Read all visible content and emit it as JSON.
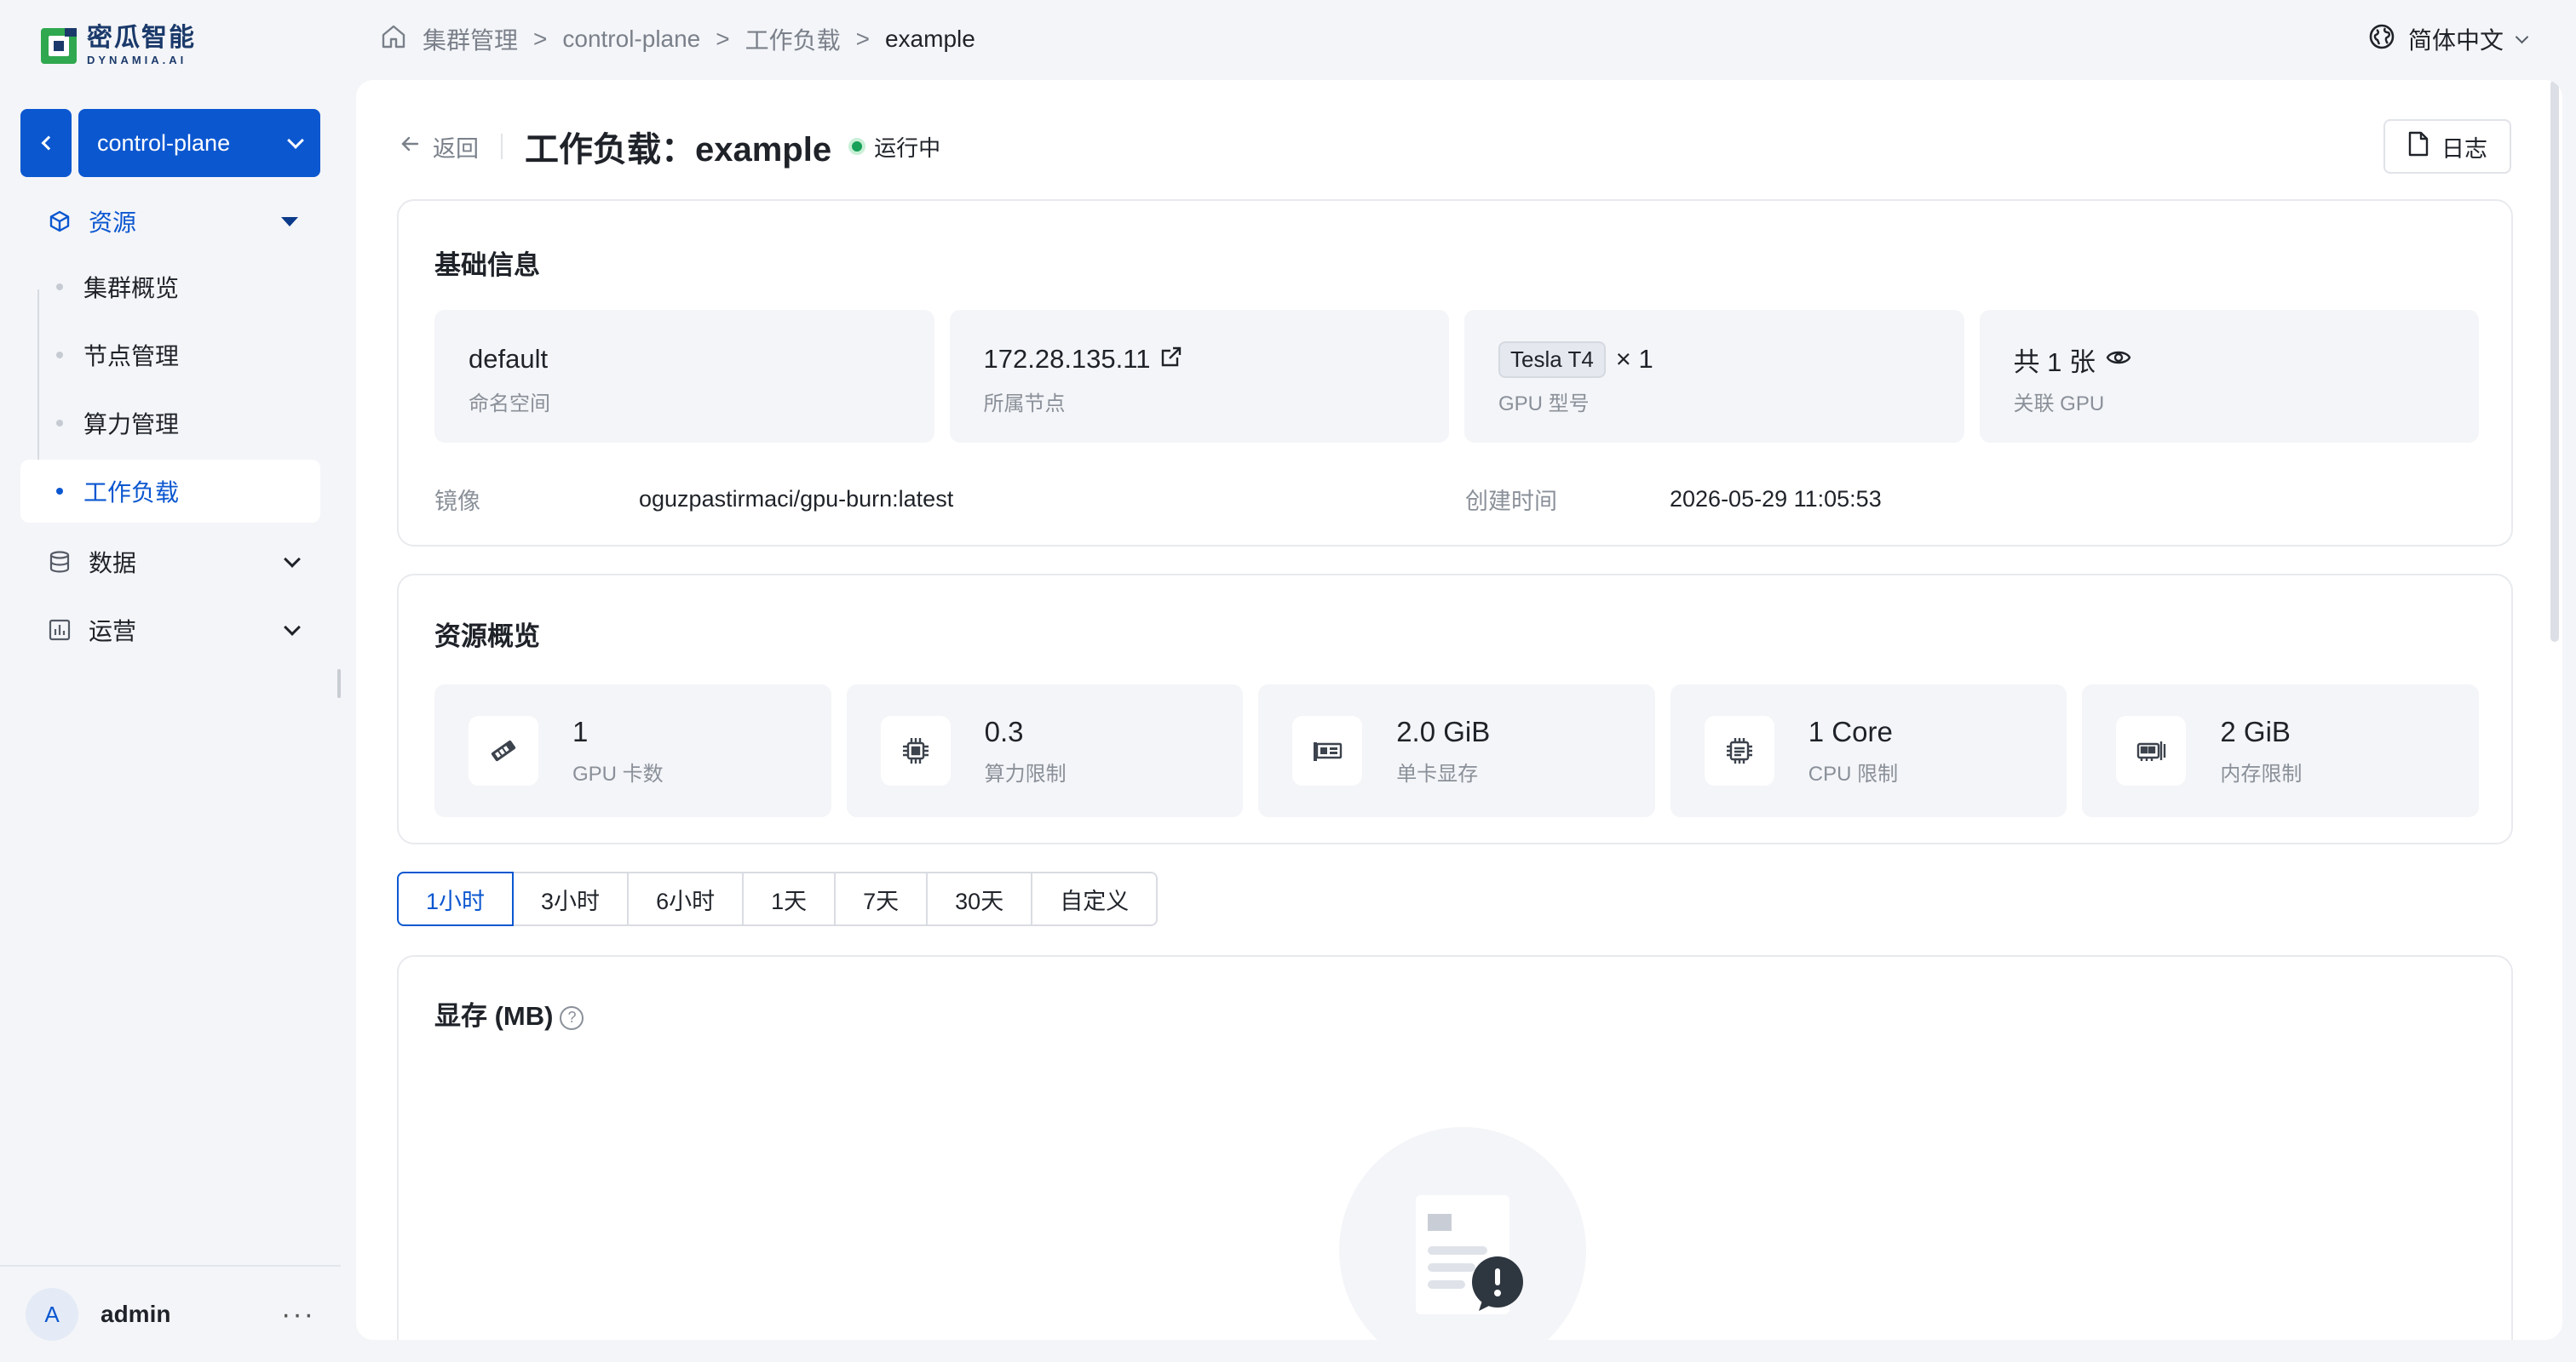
{
  "brand": {
    "name_cn": "密瓜智能",
    "name_en": "DYNAMIA.AI"
  },
  "cluster": {
    "selected": "control-plane"
  },
  "nav": {
    "groups": [
      {
        "label": "资源"
      },
      {
        "label": "数据"
      },
      {
        "label": "运营"
      }
    ],
    "resource_items": [
      {
        "label": "集群概览"
      },
      {
        "label": "节点管理"
      },
      {
        "label": "算力管理"
      },
      {
        "label": "工作负载"
      }
    ]
  },
  "user": {
    "initial": "A",
    "name": "admin",
    "more": "···"
  },
  "breadcrumb": {
    "items": [
      "集群管理",
      "control-plane",
      "工作负载",
      "example"
    ],
    "separator": ">"
  },
  "language": {
    "label": "简体中文"
  },
  "header": {
    "back_label": "返回",
    "title": "工作负载：example",
    "status": "运行中",
    "log_button": "日志"
  },
  "basic_info": {
    "title": "基础信息",
    "namespace": {
      "value": "default",
      "label": "命名空间"
    },
    "node": {
      "value": "172.28.135.11",
      "label": "所属节点"
    },
    "gpu_model": {
      "tag": "Tesla T4",
      "count": "× 1",
      "label": "GPU 型号"
    },
    "related_gpu": {
      "value": "共 1 张",
      "label": "关联 GPU"
    },
    "image": {
      "key": "镜像",
      "value": "oguzpastirmaci/gpu-burn:latest"
    },
    "created": {
      "key": "创建时间",
      "value": "2026-05-29 11:05:53"
    }
  },
  "resource_overview": {
    "title": "资源概览",
    "tiles": [
      {
        "value": "1",
        "label": "GPU 卡数",
        "icon": "gpu-card-icon"
      },
      {
        "value": "0.3",
        "label": "算力限制",
        "icon": "chip-icon"
      },
      {
        "value": "2.0 GiB",
        "label": "单卡显存",
        "icon": "memory-card-icon"
      },
      {
        "value": "1 Core",
        "label": "CPU 限制",
        "icon": "cpu-icon"
      },
      {
        "value": "2 GiB",
        "label": "内存限制",
        "icon": "ram-icon"
      }
    ]
  },
  "time_range": {
    "options": [
      "1小时",
      "3小时",
      "6小时",
      "1天",
      "7天",
      "30天",
      "自定义"
    ],
    "selected": "1小时"
  },
  "chart": {
    "title": "显存 (MB)",
    "help": "?"
  },
  "colors": {
    "primary": "#0b57d0",
    "success": "#18a058",
    "logo_green": "#2fa84f"
  }
}
